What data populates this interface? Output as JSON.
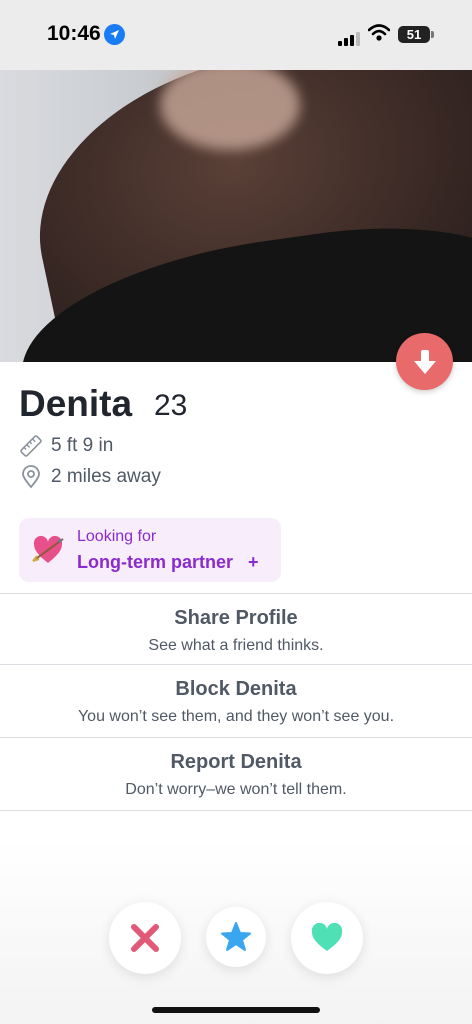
{
  "status_bar": {
    "time": "10:46",
    "battery": "51"
  },
  "profile": {
    "name": "Denita",
    "age": "23",
    "height": "5 ft 9 in",
    "distance": "2 miles away"
  },
  "looking_for": {
    "label": "Looking for",
    "value": "Long-term partner",
    "plus": "+"
  },
  "actions": [
    {
      "title": "Share Profile",
      "subtitle": "See what a friend thinks."
    },
    {
      "title": "Block Denita",
      "subtitle": "You won’t see them, and they won’t see you."
    },
    {
      "title": "Report Denita",
      "subtitle": "Don’t worry–we won’t tell them."
    }
  ],
  "colors": {
    "nope": "#e05a78",
    "super_like": "#3aa6f0",
    "like": "#4fe0b5",
    "accent_purple": "#8a2bcc",
    "collapse": "#e86a6a"
  },
  "icons": {
    "collapse": "arrow-down-icon",
    "height": "ruler-icon",
    "distance": "location-pin-icon",
    "looking_for": "heart-arrow-emoji",
    "nope": "x-icon",
    "super_like": "star-icon",
    "like": "heart-icon"
  }
}
